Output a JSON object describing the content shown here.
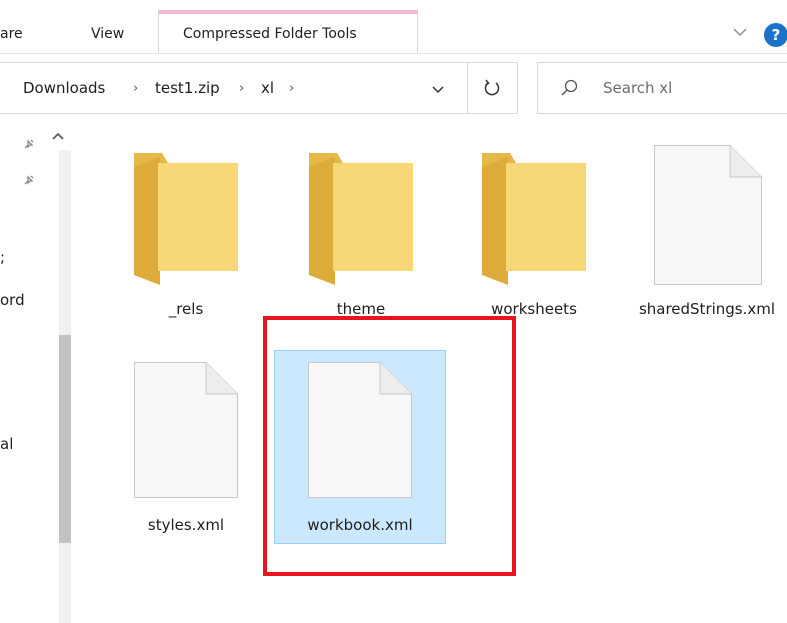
{
  "ribbon": {
    "tabs": [
      "are",
      "View"
    ],
    "contextual_tab": "Compressed Folder Tools",
    "contextual_color": "#f2b9d6",
    "help_label": "?"
  },
  "address_bar": {
    "crumbs": [
      "Downloads",
      "test1.zip",
      "xl"
    ],
    "separator": "›"
  },
  "search": {
    "placeholder": "Search xl"
  },
  "nav_pane": {
    "fragments": [
      ";",
      "ord",
      "al"
    ]
  },
  "items": [
    {
      "name": "_rels",
      "type": "folder"
    },
    {
      "name": "theme",
      "type": "folder"
    },
    {
      "name": "worksheets",
      "type": "folder"
    },
    {
      "name": "sharedStrings.xml",
      "type": "file"
    },
    {
      "name": "styles.xml",
      "type": "file"
    },
    {
      "name": "workbook.xml",
      "type": "file",
      "selected": true
    }
  ],
  "colors": {
    "folder": "#f8d776",
    "folder_dark": "#e6b84a",
    "selection": "#cce8ff",
    "highlight": "#e8141e",
    "help": "#1a73c8"
  }
}
